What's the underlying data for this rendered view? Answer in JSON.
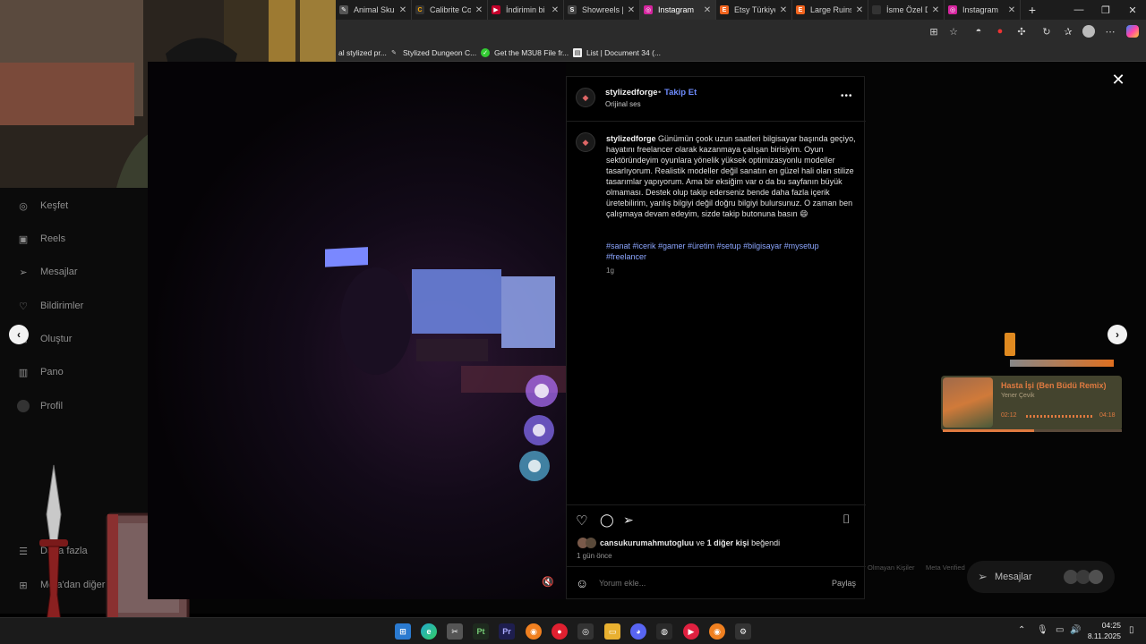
{
  "browser": {
    "tabs": [
      {
        "label": "Animal Skul",
        "color": "#555"
      },
      {
        "label": "Calibrite Co",
        "color": "#333"
      },
      {
        "label": "İndirimin bi",
        "color": "#c4002b"
      },
      {
        "label": "Showreels |",
        "color": "#444"
      },
      {
        "label": "Instagram",
        "color": "#d6249f"
      },
      {
        "label": "Etsy Türkiye",
        "color": "#f1641e"
      },
      {
        "label": "Large Ruins",
        "color": "#f1641e"
      },
      {
        "label": "İsme Özel D",
        "color": "#333"
      },
      {
        "label": "Instagram",
        "color": "#d6249f"
      }
    ],
    "new_tab": "+",
    "minimize": "—",
    "restore": "❐",
    "close": "✕",
    "bookmarks": [
      {
        "label": "al stylized pr..."
      },
      {
        "label": "Stylized Dungeon C..."
      },
      {
        "label": "Get the M3U8 File fr..."
      },
      {
        "label": "List | Document 34 (..."
      }
    ]
  },
  "sidebar": {
    "items": [
      {
        "label": "Keşfet",
        "icon": "compass-icon"
      },
      {
        "label": "Reels",
        "icon": "reels-icon"
      },
      {
        "label": "Mesajlar",
        "icon": "send-icon"
      },
      {
        "label": "Bildirimler",
        "icon": "heart-icon"
      },
      {
        "label": "Oluştur",
        "icon": "plus-icon"
      },
      {
        "label": "Pano",
        "icon": "dashboard-icon"
      },
      {
        "label": "Profil",
        "icon": "avatar-icon"
      }
    ],
    "more": "Daha fazla",
    "also_from_meta": "Meta'dan diğer"
  },
  "post": {
    "author": "stylizedforge",
    "follow": "Takip Et",
    "audio": "Orijinal ses",
    "caption": "Günümün çook uzun saatleri bilgisayar başında geçiyo, hayatını freelancer olarak kazanmaya çalışan birisiyim. Oyun sektöründeyim oyunlara yönelik yüksek optimizasyonlu modeller tasarlıyorum. Realistik modeller değil sanatın en güzel hali olan stilize tasarımlar yapıyorum. Ama bir eksiğim var o da bu sayfanın büyük olmaması. Destek olup takip ederseniz bende daha fazla içerik üretebilirim, yanlış bilgiyi değil doğru bilgiyi bulursunuz. O zaman ben çalışmaya devam edeyim, sizde takip butonuna basın 😄",
    "hashtags": "#sanat #icerik #gamer #üretim #setup #bilgisayar #mysetup #freelancer",
    "caption_age": "1g",
    "liked_by_user": "cansukurumahmutogluu",
    "liked_by_rest": "ve",
    "liked_by_others": "1 diğer kişi",
    "liked_by_suffix": "beğendi",
    "post_age": "1 gün önce",
    "comment_placeholder": "Yorum ekle...",
    "share": "Paylaş",
    "more_icon": "•••"
  },
  "music": {
    "title": "Hasta İşi (Ben Büdü Remix)",
    "artist": "Yener Çevik",
    "elapsed": "02:12",
    "total": "04:18",
    "progress": 0.51
  },
  "footer": {
    "links": [
      "Olmayan Kişiler",
      "Meta Verified"
    ]
  },
  "messages_pill": {
    "label": "Mesajlar"
  },
  "taskbar": {
    "time": "04:25",
    "date": "8.11.2025"
  },
  "colors": {
    "accent_link": "#8ca6ff",
    "follow_blue": "#6e8cff",
    "instagram": "#d6249f"
  }
}
